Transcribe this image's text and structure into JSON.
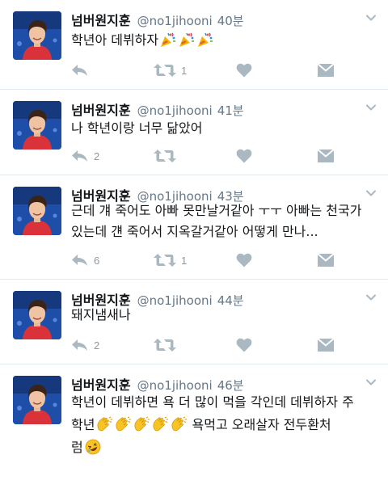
{
  "tweets": [
    {
      "name": "넘버원지훈",
      "handle": "@no1jihooni",
      "time": "40분",
      "lines": [
        "학년아 데뷔하자"
      ],
      "emoji": [
        "party-popper",
        "party-popper",
        "party-popper"
      ],
      "reply_count": "",
      "retweet_count": "1"
    },
    {
      "name": "넘버원지훈",
      "handle": "@no1jihooni",
      "time": "41분",
      "lines": [
        "나 학년이랑 너무 닮았어"
      ],
      "reply_count": "2",
      "retweet_count": ""
    },
    {
      "name": "넘버원지훈",
      "handle": "@no1jihooni",
      "time": "43분",
      "lines": [
        "근데 걔 죽어도 아빠 못만날거같아 ㅜㅜ 아빠는 천국가",
        "있는데 걘 죽어서 지옥갈거같아 어떻게 만나..."
      ],
      "reply_count": "6",
      "retweet_count": "1"
    },
    {
      "name": "넘버원지훈",
      "handle": "@no1jihooni",
      "time": "44분",
      "lines": [
        "돼지냄새나"
      ],
      "reply_count": "2",
      "retweet_count": ""
    },
    {
      "name": "넘버원지훈",
      "handle": "@no1jihooni",
      "time": "46분",
      "lines": [
        "학년이 데뷔하면 욕 더 많이 먹을 각인데 데뷔하자 주",
        "학년",
        " 욕먹고 오래살자 전두환처",
        "럼"
      ],
      "emoji": [
        "clapping-hands",
        "clapping-hands",
        "clapping-hands",
        "clapping-hands",
        "clapping-hands",
        "rolling-on-floor-laughing"
      ]
    }
  ],
  "icons": {
    "reply": "reply-icon",
    "retweet": "retweet-icon",
    "like": "heart-icon",
    "dm": "envelope-icon",
    "caret": "chevron-down-icon"
  },
  "colors": {
    "text": "#14171a",
    "muted": "#657786",
    "action_icon": "#aab8c2",
    "divider": "#e1e8ed"
  }
}
